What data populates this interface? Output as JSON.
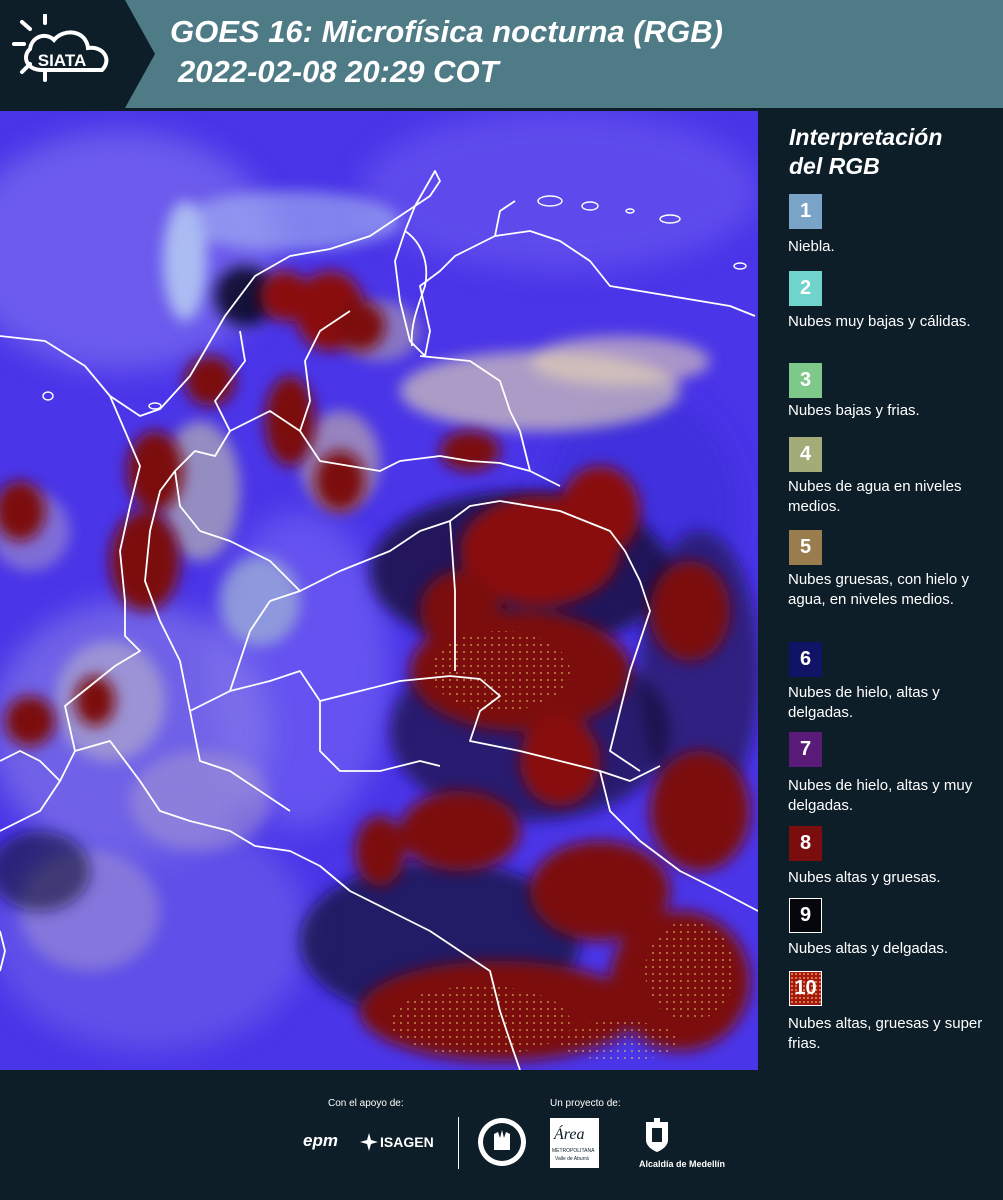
{
  "header": {
    "logo_text": "SIATA",
    "title_line1": "GOES 16: Microfísica nocturna (RGB)",
    "title_line2": "2022-02-08 20:29 COT"
  },
  "legend": {
    "title_line1": "Interpretación",
    "title_line2": "del RGB",
    "items": [
      {
        "number": "1",
        "color": "#7aa3c8",
        "label": "Niebla."
      },
      {
        "number": "2",
        "color": "#6fd4cc",
        "label": "Nubes muy bajas y cálidas."
      },
      {
        "number": "3",
        "color": "#7ec98a",
        "label": "Nubes bajas y frias."
      },
      {
        "number": "4",
        "color": "#a3ac78",
        "label": "Nubes de agua en niveles medios."
      },
      {
        "number": "5",
        "color": "#9a7d4e",
        "label": "Nubes gruesas, con hielo y agua, en niveles medios."
      },
      {
        "number": "6",
        "color": "#111466",
        "label": "Nubes de hielo, altas y delgadas."
      },
      {
        "number": "7",
        "color": "#5a1a78",
        "label": "Nubes de hielo, altas y muy delgadas."
      },
      {
        "number": "8",
        "color": "#7a0d0d",
        "label": "Nubes altas y gruesas."
      },
      {
        "number": "9",
        "color": "#05070c",
        "label": "Nubes altas y delgadas."
      },
      {
        "number": "10",
        "color": "#a5170f",
        "label": "Nubes altas, gruesas y super frias."
      }
    ]
  },
  "footer": {
    "support_label": "Con el apoyo de:",
    "project_label": "Un proyecto de:",
    "epm": "epm",
    "isagen": "ISAGEN",
    "area_name": "Área",
    "area_sub": "METROPOLITANA",
    "area_sub2": "Valle de Aburrá",
    "alcaldia": "Alcaldía de Medellín"
  }
}
